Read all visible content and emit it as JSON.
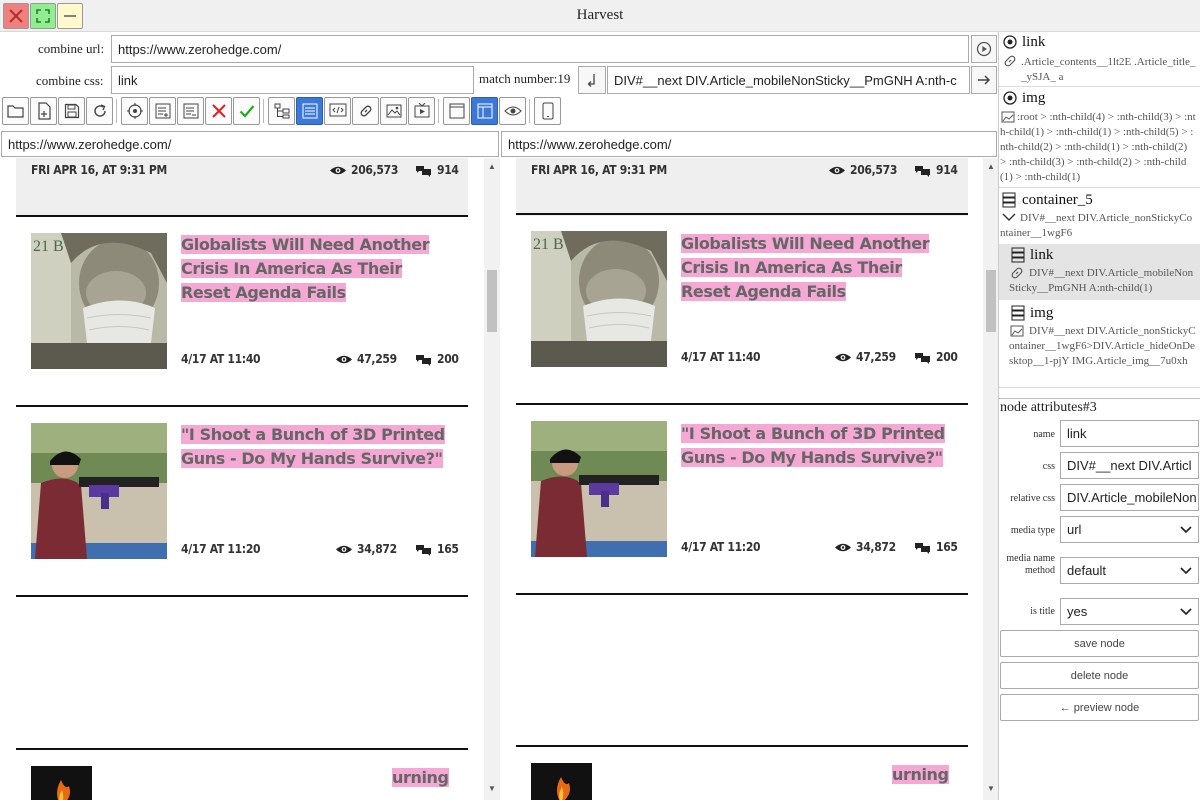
{
  "window": {
    "title": "Harvest"
  },
  "combine": {
    "url_label": "combine url:",
    "url_value": "https://www.zerohedge.com/",
    "css_label": "combine css:",
    "css_value": "link",
    "match_label": "match number:",
    "match_value": "19",
    "path_value": "DIV#__next DIV.Article_mobileNonSticky__PmGNH A:nth-c"
  },
  "addresses": {
    "left": "https://www.zerohedge.com/",
    "right": "https://www.zerohedge.com/"
  },
  "articles": [
    {
      "date": "FRI APR 16, AT 9:31 PM",
      "views": "206,573",
      "comments": "914"
    },
    {
      "title": "Globalists Will Need Another Crisis In America As Their Reset Agenda Fails",
      "date": "4/17 AT 11:40",
      "views": "47,259",
      "comments": "200"
    },
    {
      "title": "\"I Shoot a Bunch of 3D Printed Guns - Do My Hands Survive?\"",
      "date": "4/17 AT 11:20",
      "views": "34,872",
      "comments": "165"
    },
    {
      "title": "urning"
    }
  ],
  "tree": [
    {
      "name": "link",
      "css": ".Article_contents__1lt2E .Article_title__ySJA_ a"
    },
    {
      "name": "img",
      "css": ":root > :nth-child(4) > :nth-child(3) > :nth-child(1) > :nth-child(1) > :nth-child(5) > :nth-child(2) > :nth-child(1) > :nth-child(2) > :nth-child(3) > :nth-child(2) > :nth-child(1) > :nth-child(1)"
    },
    {
      "name": "container_5",
      "css": "DIV#__next DIV.Article_nonStickyContainer__1wgF6"
    },
    {
      "name": "link",
      "css": "DIV#__next DIV.Article_mobileNonSticky__PmGNH A:nth-child(1)"
    },
    {
      "name": "img",
      "css": "DIV#__next DIV.Article_nonStickyContainer__1wgF6>DIV.Article_hideOnDesktop__1-pjY IMG.Article_img__7u0xh"
    }
  ],
  "attributes": {
    "title": "node attributes#3",
    "name_label": "name",
    "name_value": "link",
    "css_label": "css",
    "css_value": "DIV#__next DIV.Articl",
    "rel_label": "relative css",
    "rel_value": "DIV.Article_mobileNon",
    "media_label": "media type",
    "media_value": "url",
    "method_label": "media name method",
    "method_value": "default",
    "istitle_label": "is title",
    "istitle_value": "yes",
    "save": "save node",
    "delete": "delete node",
    "preview": "← preview node"
  },
  "colors": {
    "highlight": "#f5a8d4",
    "active_tool": "#3b78d8",
    "close": "#f08080",
    "maximize": "#90ee90",
    "minimize": "#fffacd"
  }
}
